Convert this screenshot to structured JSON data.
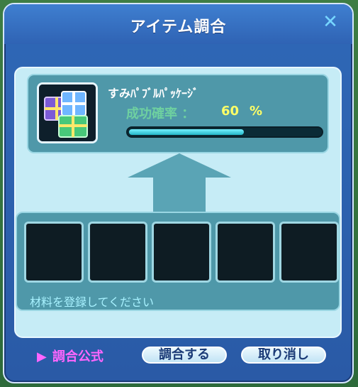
{
  "window": {
    "title": "アイテム調合",
    "close_icon": "close-icon"
  },
  "result": {
    "item_name": "すみﾊﾟﾌﾞﾙﾊﾟｯｹｰｼﾞ",
    "success_rate_label": "成功確率 ：",
    "success_rate_value": "60",
    "success_rate_unit": "%",
    "success_rate_fraction": 0.6,
    "item_icon": "gift-package-icon"
  },
  "materials": {
    "slot_count": 5,
    "hint": "材料を登録してください"
  },
  "footer": {
    "formula_label": "調合公式",
    "formula_icon": "triangle-right-icon",
    "combine_button": "調合する",
    "cancel_button": "取り消し"
  },
  "colors": {
    "window_blue": "#2f68b7",
    "panel_cyan": "#4f98a9",
    "rate_yellow": "#ffff66",
    "formula_pink": "#ff66ff"
  }
}
